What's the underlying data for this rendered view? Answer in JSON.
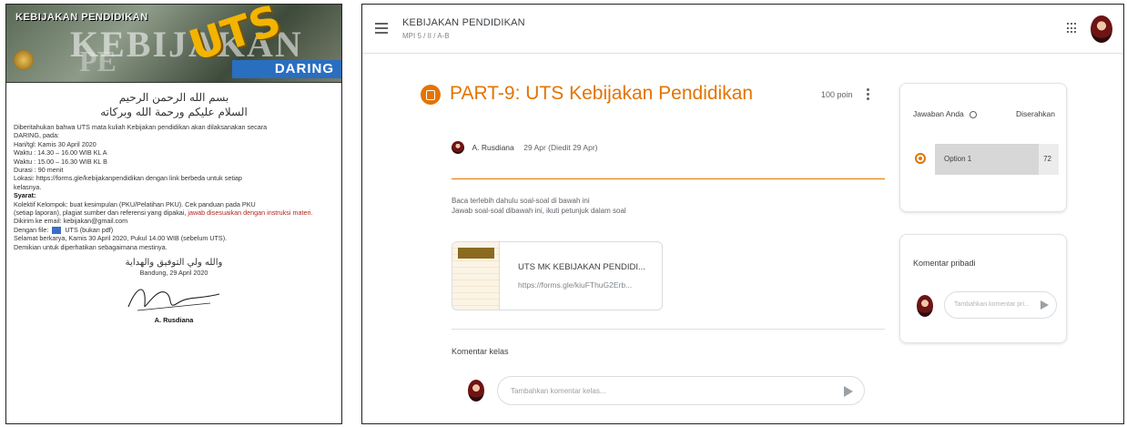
{
  "announcement": {
    "banner": {
      "title": "KEBIJAKAN PENDIDIKAN",
      "big_text_1": "KEBIJAKAN",
      "big_text_2": "PE",
      "uts": "UTS",
      "daring": "DARING"
    },
    "arabic_1": "بسم الله الرحمن الرحيم",
    "arabic_2": "السلام عليكم ورحمة الله وبركاته",
    "lines": [
      "Diberitahukan bahwa UTS mata kuliah Kebijakan pendidikan akan dilaksanakan secara",
      "DARING, pada:",
      "Hari/tgl: Kamis 30 April 2020",
      "Waktu : 14.30 – 16.00 WIB KL A",
      "Waktu : 15.00 – 16.30 WIB KL B",
      "Durasi : 90 menit",
      "Lokasi: https://forms.gle/kebijakanpendidikan  dengan link berbeda untuk setiap",
      "kelasnya."
    ],
    "syarat_label": "Syarat:",
    "syarat_text": "Kolektif Kelompok: buat kesimpulan (PKU/Pelatihan PKU). Cek panduan pada PKU",
    "syarat_text_2": "(setiap laporan), plagiat sumber dan referensi yang dipakai, ",
    "syarat_red": "jawab disesuaikan dengan instruksi materi.",
    "email_line": "Dikirim ke email: kebijakan@gmail.com",
    "attach_label": "Dengan file:",
    "attach_text": "UTS (bukan pdf)",
    "closing_1": "Selamat berkarya, Kamis 30 April 2020, Pukul 14.00 WIB (sebelum UTS).",
    "closing_2": "Demikian untuk diperhatikan sebagaimana mestinya.",
    "arabic_3": "والله ولي التوفيق والهداية",
    "place_date": "Bandung, 29 April 2020",
    "signer": "A. Rusdiana"
  },
  "classroom": {
    "topbar": {
      "course_title": "KEBIJAKAN PENDIDIKAN",
      "course_sub": "MPI 5 / II / A-B"
    },
    "assignment": {
      "title": "PART-9: UTS Kebijakan Pendidikan",
      "points": "100 poin",
      "author": "A. Rusdiana",
      "date": "29 Apr (Diedit 29 Apr)",
      "instructions_1": "Baca terlebih dahulu soal-soal di bawah ini",
      "instructions_2": "Jawab soal-soal dibawah ini, ikuti petunjuk dalam soal",
      "attachment_title": "UTS MK KEBIJAKAN PENDIDI...",
      "attachment_url": "https://forms.gle/kiuFThuG2Erb...",
      "attachment_thumb_text": "KEB"
    },
    "class_comments": {
      "label": "Komentar kelas",
      "placeholder": "Tambahkan komentar kelas..."
    },
    "your_work": {
      "title": "Jawaban Anda",
      "status": "Diserahkan",
      "option_label": "Option 1",
      "option_count": "72",
      "option_fraction": 0.84,
      "accent": "#e37400"
    },
    "private_comments": {
      "title": "Komentar pribadi",
      "placeholder": "Tambahkan komentar pri..."
    }
  }
}
